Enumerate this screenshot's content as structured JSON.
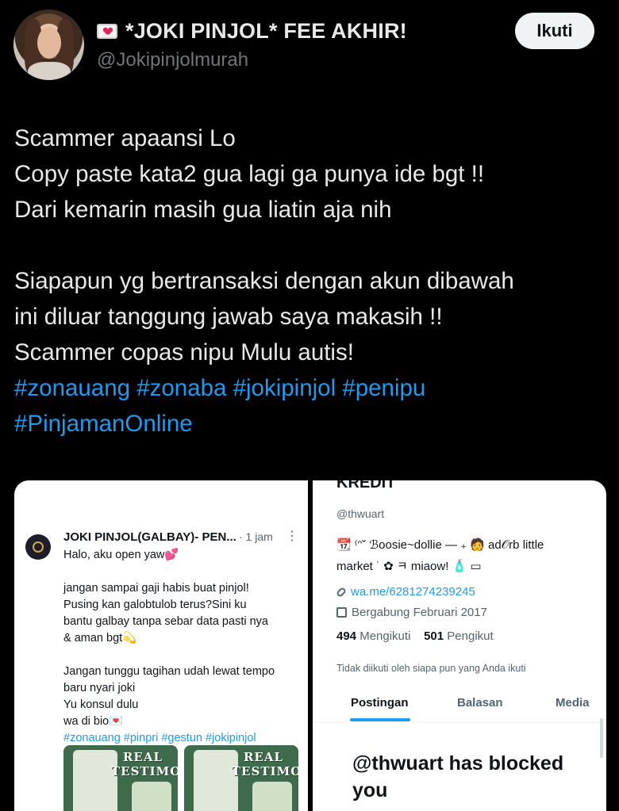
{
  "header": {
    "display_name": "*JOKI PINJOL* FEE AKHIR!",
    "handle": "@Jokipinjolmurah",
    "follow_label": "Ikuti"
  },
  "tweet": {
    "lines": [
      "Scammer apaansi Lo",
      "Copy paste kata2 gua lagi ga punya ide bgt !!",
      "Dari kemarin masih gua liatin aja nih",
      "",
      "Siapapun yg bertransaksi dengan akun dibawah",
      "ini diluar tanggung jawab saya makasih !!",
      "Scammer copas nipu Mulu autis!"
    ],
    "hashtags_line1": "#zonauang #zonaba #jokipinjol #penipu",
    "hashtags_line2": "#PinjamanOnline"
  },
  "left_screenshot": {
    "name": "JOKI PINJOL(GALBAY)- PEN...",
    "time": "· 1 jam",
    "more": "⋮",
    "lines": [
      "Halo, aku open yaw💕",
      "",
      "jangan sampai gaji habis buat pinjol!",
      "Pusing kan galobtulob terus?Sini ku",
      "bantu galbay tanpa sebar data pasti nya",
      "& aman bgt💫",
      "",
      "Jangan tunggu tagihan udah lewat tempo",
      "baru nyari joki",
      "Yu konsul dulu",
      "wa di bio💌"
    ],
    "hashtags": "#zonauang #pinpri #gestun #jokipinjol",
    "image_label": "REAL TESTIMONI"
  },
  "right_screenshot": {
    "title": "KREDIT",
    "handle": "@thwuart",
    "bio_line1": "📆 ⁽ᵔ˘ ℬoosie~dollie ⎯⎯ ₊ 🧑 ad𝒪rb little",
    "bio_line2": "market ˙ ✿ ㅋ miaow! 🧴 ▭",
    "link": "wa.me/6281274239245",
    "joined": "Bergabung Februari 2017",
    "following_count": "494",
    "following_label": "Mengikuti",
    "followers_count": "501",
    "followers_label": "Pengikut",
    "not_followed": "Tidak diikuti oleh siapa pun yang Anda ikuti",
    "tabs": [
      "Postingan",
      "Balasan",
      "Media"
    ],
    "blocked": "@thwuart has blocked you"
  },
  "colors": {
    "background": "#000000",
    "text": "#e7e9ea",
    "muted": "#71767b",
    "link": "#1d9bf0"
  }
}
